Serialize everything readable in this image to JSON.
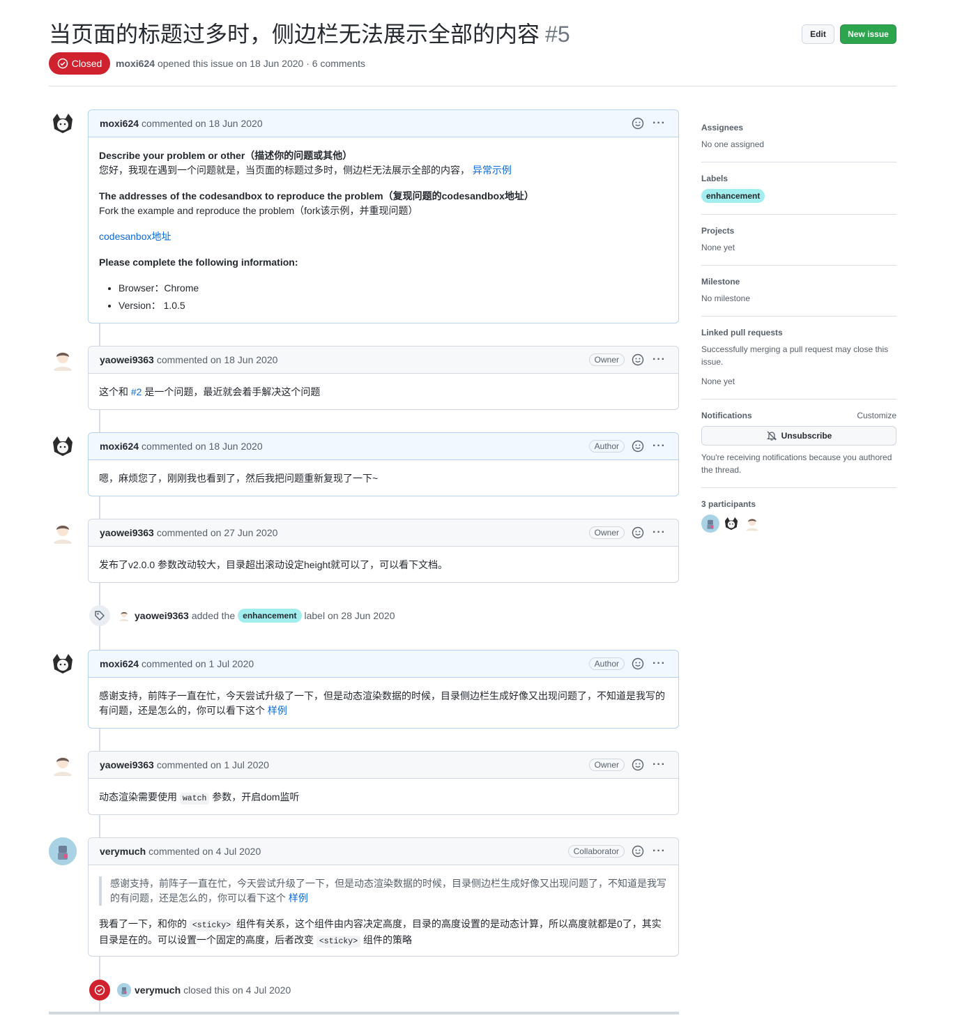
{
  "issue": {
    "title": "当页面的标题过多时，侧边栏无法展示全部的内容",
    "number": "#5",
    "state": "Closed",
    "author": "moxi624",
    "meta_text": "opened this issue on 18 Jun 2020 · 6 comments"
  },
  "header_buttons": {
    "edit": "Edit",
    "new_issue": "New issue"
  },
  "comments": [
    {
      "author": "moxi624",
      "date": "commented on 18 Jun 2020",
      "role": "",
      "body": {
        "h1": "Describe your problem or other（描述你的问题或其他）",
        "p1": "您好，我现在遇到一个问题就是，当页面的标题过多时，侧边栏无法展示全部的内容，",
        "p1_link": "异常示例",
        "h2": "The addresses of the codesandbox to reproduce the problem（复现问题的codesandbox地址）",
        "p2": "Fork the example and reproduce the problem（fork该示例，并重现问题）",
        "link": "codesanbox地址",
        "h3": "Please complete the following information:",
        "li1": "Browser：Chrome",
        "li2": "Version： 1.0.5"
      }
    },
    {
      "author": "yaowei9363",
      "date": "commented on 18 Jun 2020",
      "role": "Owner",
      "body": {
        "pre": "这个和 ",
        "link": "#2",
        "post": " 是一个问题，最近就会着手解决这个问题"
      }
    },
    {
      "author": "moxi624",
      "date": "commented on 18 Jun 2020",
      "role": "Author",
      "body": {
        "text": "嗯，麻烦您了，刚刚我也看到了，然后我把问题重新复现了一下~"
      }
    },
    {
      "author": "yaowei9363",
      "date": "commented on 27 Jun 2020",
      "role": "Owner",
      "body": {
        "text": "发布了v2.0.0 参数改动较大，目录超出滚动设定height就可以了，可以看下文档。"
      }
    },
    {
      "author": "moxi624",
      "date": "commented on 1 Jul 2020",
      "role": "Author",
      "body": {
        "text": "感谢支持，前阵子一直在忙，今天尝试升级了一下，但是动态渲染数据的时候，目录侧边栏生成好像又出现问题了，不知道是我写的有问题，还是怎么的，你可以看下这个 ",
        "link": "样例"
      }
    },
    {
      "author": "yaowei9363",
      "date": "commented on 1 Jul 2020",
      "role": "Owner",
      "body": {
        "pre": "动态渲染需要使用 ",
        "code": "watch",
        "post": " 参数，开启dom监听"
      }
    },
    {
      "author": "verymuch",
      "date": "commented on 4 Jul 2020",
      "role": "Collaborator",
      "body": {
        "quote": "感谢支持，前阵子一直在忙，今天尝试升级了一下，但是动态渲染数据的时候，目录侧边栏生成好像又出现问题了，不知道是我写的有问题，还是怎么的，你可以看下这个 ",
        "quote_link": "样例",
        "t1": "我看了一下，和你的 ",
        "code1": "<sticky>",
        "t2": " 组件有关系，这个组件由内容决定高度，目录的高度设置的是动态计算，所以高度就都是0了，其实目录是在的。可以设置一个固定的高度，后者改变 ",
        "code2": "<sticky>",
        "t3": " 组件的策略"
      }
    }
  ],
  "events": {
    "label": {
      "actor": "yaowei9363",
      "action": "added the",
      "label": "enhancement",
      "suffix": "label on 28 Jun 2020"
    },
    "closed": {
      "actor": "verymuch",
      "action": "closed this on 4 Jul 2020"
    }
  },
  "sidebar": {
    "assignees": {
      "title": "Assignees",
      "value": "No one assigned"
    },
    "labels": {
      "title": "Labels",
      "value": "enhancement"
    },
    "projects": {
      "title": "Projects",
      "value": "None yet"
    },
    "milestone": {
      "title": "Milestone",
      "value": "No milestone"
    },
    "linked": {
      "title": "Linked pull requests",
      "desc": "Successfully merging a pull request may close this issue.",
      "value": "None yet"
    },
    "notifications": {
      "title": "Notifications",
      "customize": "Customize",
      "button": "Unsubscribe",
      "desc": "You're receiving notifications because you authored the thread."
    },
    "participants": {
      "title": "3 participants"
    }
  },
  "colors": {
    "closed_red": "#cf222e",
    "green": "#2da44e",
    "link": "#0969da",
    "label_bg": "#a2eeef"
  }
}
